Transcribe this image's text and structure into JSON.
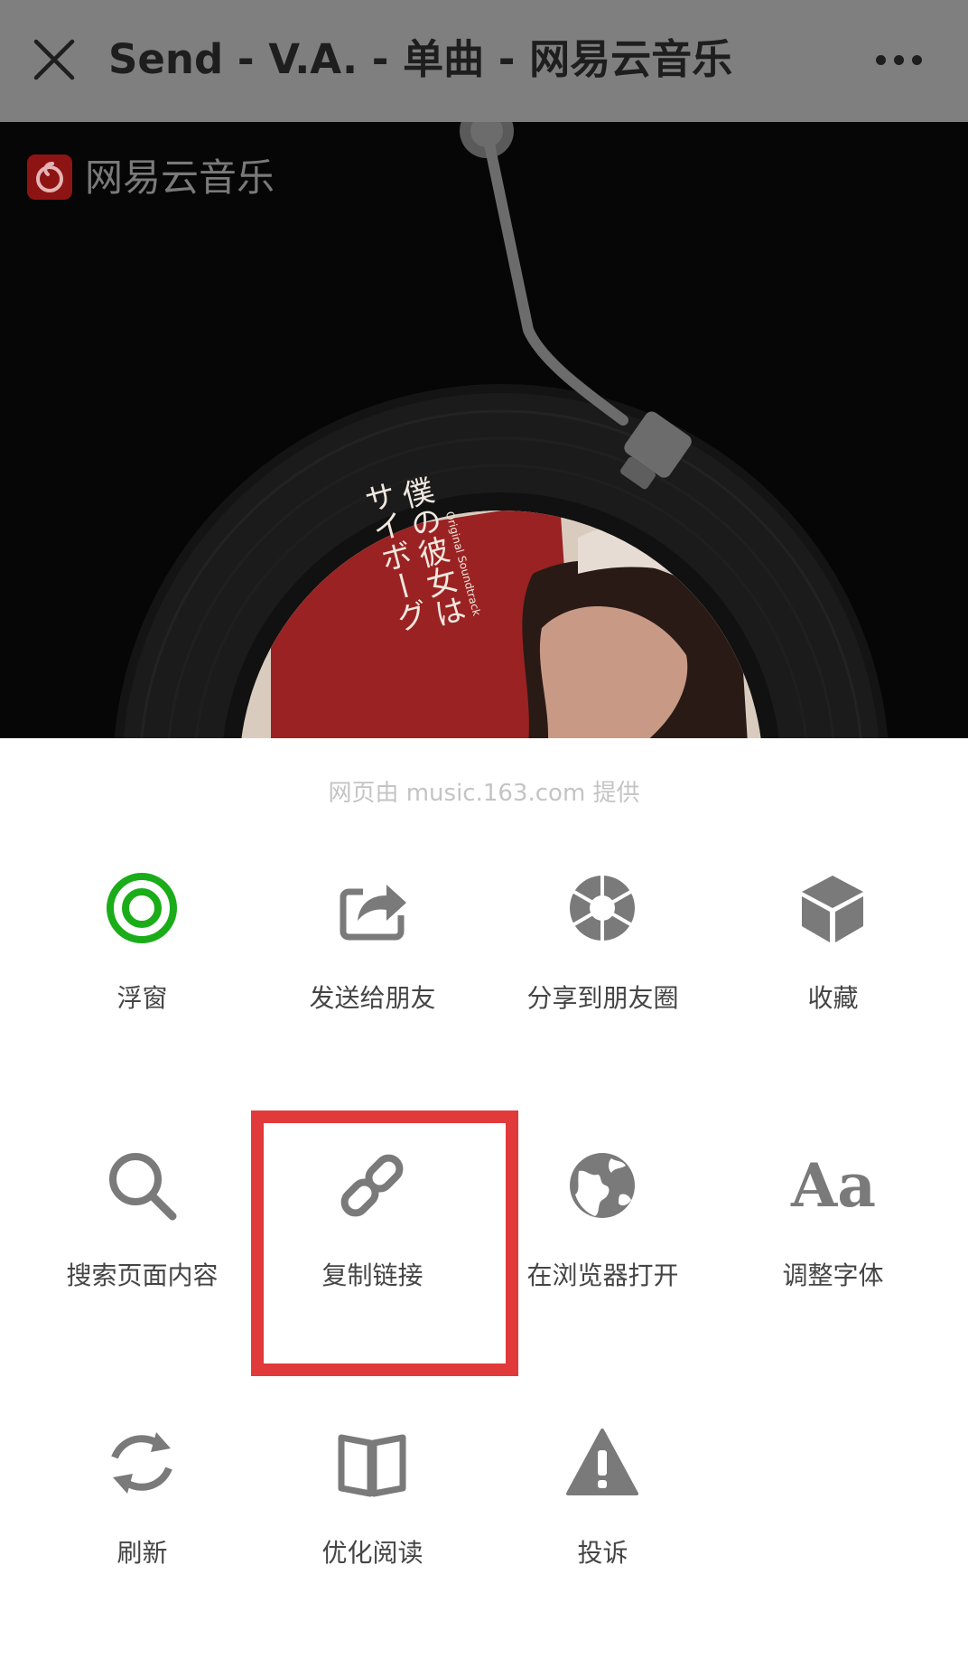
{
  "header": {
    "title": "Send - V.A. - 单曲 - 网易云音乐",
    "close_icon": "close-icon",
    "more_icon": "more-icon"
  },
  "page": {
    "brand_name": "网易云音乐",
    "album_text_vertical_1": "僕の彼女は",
    "album_text_vertical_2": "サイボーグ",
    "album_text_small": "Original Soundtrack"
  },
  "sheet": {
    "provider": "网页由 music.163.com 提供",
    "items": [
      {
        "label": "浮窗",
        "icon": "floating-window-icon"
      },
      {
        "label": "发送给朋友",
        "icon": "share-arrow-icon"
      },
      {
        "label": "分享到朋友圈",
        "icon": "moments-shutter-icon"
      },
      {
        "label": "收藏",
        "icon": "favorite-cube-icon"
      },
      {
        "label": "搜索页面内容",
        "icon": "search-icon"
      },
      {
        "label": "复制链接",
        "icon": "link-icon"
      },
      {
        "label": "在浏览器打开",
        "icon": "globe-icon"
      },
      {
        "label": "调整字体",
        "icon": "font-size-icon",
        "glyph": "Aa"
      },
      {
        "label": "刷新",
        "icon": "refresh-icon"
      },
      {
        "label": "优化阅读",
        "icon": "book-icon"
      },
      {
        "label": "投诉",
        "icon": "warning-icon"
      }
    ]
  },
  "colors": {
    "topbar": "#7f7f7f",
    "accent_green": "#1aad19",
    "icon_gray": "#7a7a7a",
    "highlight_red": "#e03a3a"
  }
}
